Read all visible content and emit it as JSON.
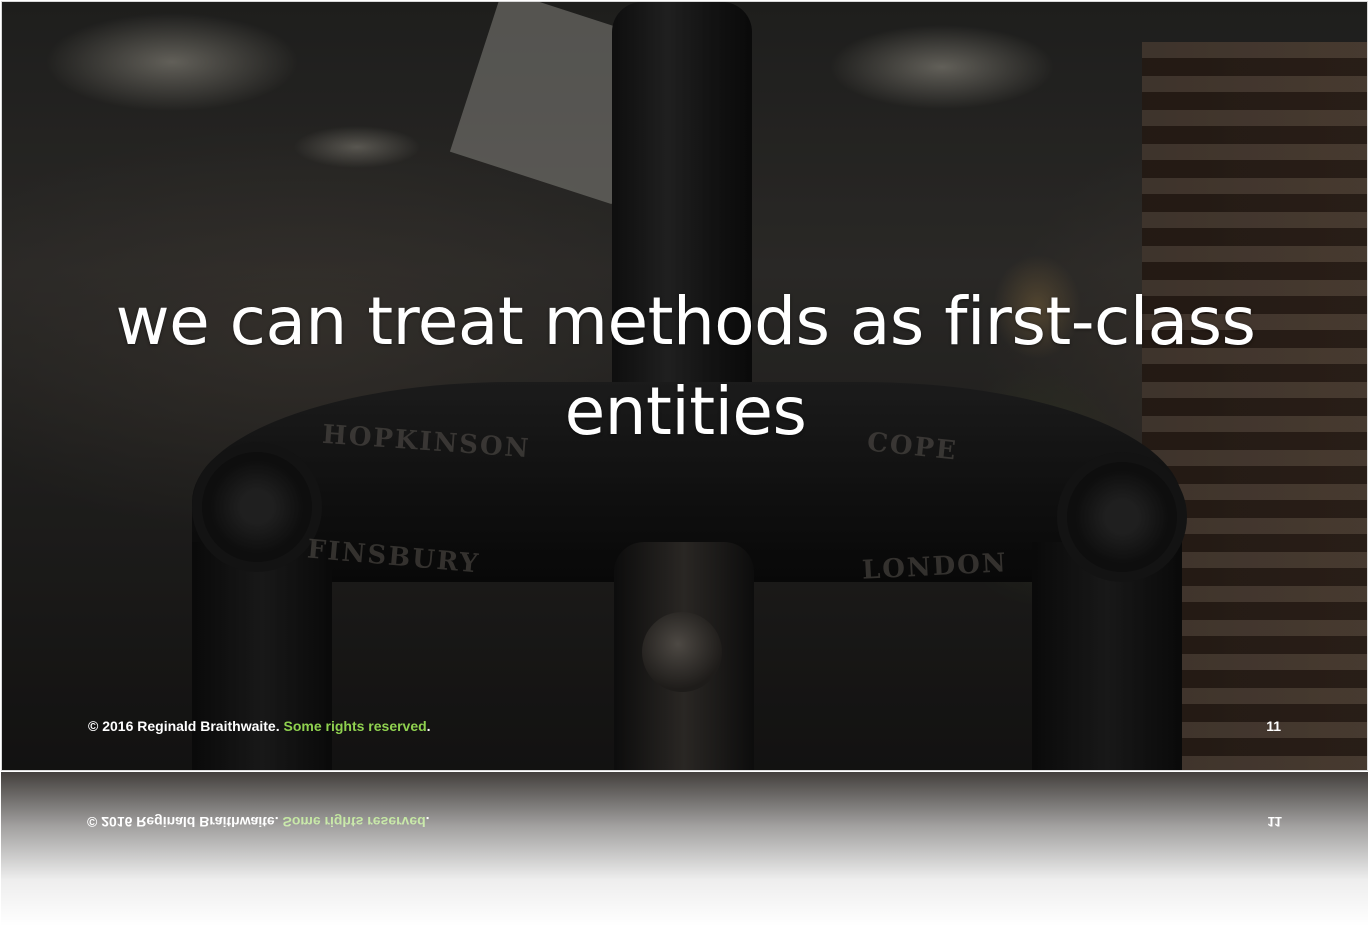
{
  "slide": {
    "headline_line1": "we can treat methods as first-class",
    "headline_line2": "entities",
    "background_image_description_icon": "printing-press-photo",
    "footer": {
      "copyright": "© 2016 Reginald Braithwaite.",
      "rights": "Some rights reserved",
      "period": ".",
      "page_number": "11"
    },
    "engravings": {
      "left_top": "HOPKINSON",
      "right_top": "COPE",
      "left_bottom": "FINSBURY",
      "right_bottom": "LONDON"
    }
  },
  "colors": {
    "headline": "#ffffff",
    "footer_text": "#ffffff",
    "rights_link": "#8fd14f"
  }
}
